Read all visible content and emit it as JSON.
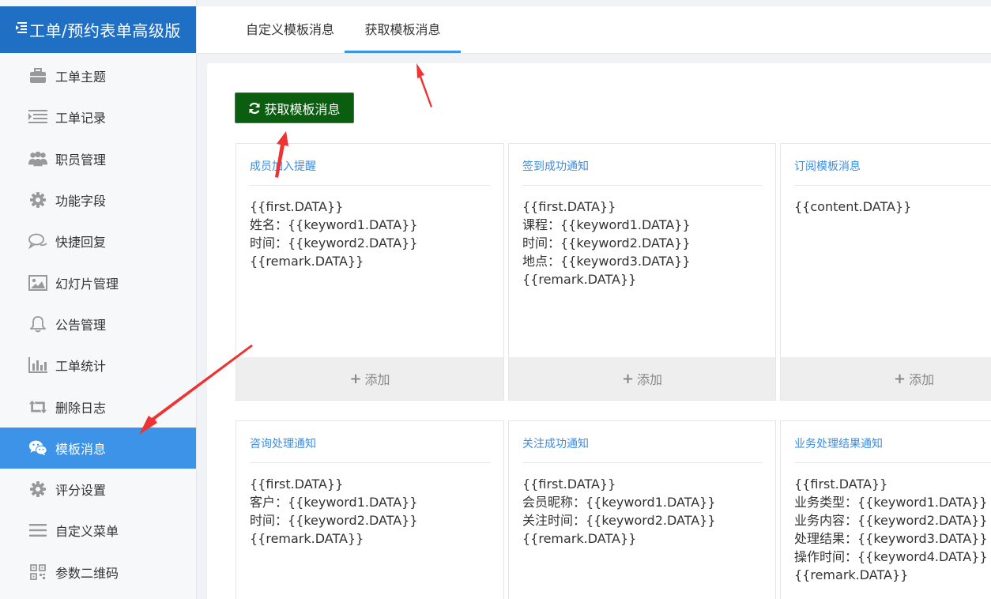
{
  "app": {
    "title": "工单/预约表单高级版"
  },
  "sidebar": {
    "items": [
      {
        "label": "工单主题",
        "icon": "briefcase-icon"
      },
      {
        "label": "工单记录",
        "icon": "list-icon"
      },
      {
        "label": "职员管理",
        "icon": "users-icon"
      },
      {
        "label": "功能字段",
        "icon": "gear-icon"
      },
      {
        "label": "快捷回复",
        "icon": "chat-bubble-icon"
      },
      {
        "label": "幻灯片管理",
        "icon": "image-icon"
      },
      {
        "label": "公告管理",
        "icon": "bell-icon"
      },
      {
        "label": "工单统计",
        "icon": "bar-chart-icon"
      },
      {
        "label": "删除日志",
        "icon": "retweet-icon"
      },
      {
        "label": "模板消息",
        "icon": "wechat-icon",
        "active": true
      },
      {
        "label": "评分设置",
        "icon": "gear-icon"
      },
      {
        "label": "自定义菜单",
        "icon": "menu-icon"
      },
      {
        "label": "参数二维码",
        "icon": "qrcode-icon"
      }
    ]
  },
  "tabs": [
    {
      "label": "自定义模板消息",
      "active": false
    },
    {
      "label": "获取模板消息",
      "active": true
    }
  ],
  "toolbar": {
    "fetch_label": "获取模板消息"
  },
  "cards": [
    {
      "title": "成员加入提醒",
      "body": "{{first.DATA}}\n姓名：{{keyword1.DATA}}\n时间：{{keyword2.DATA}}\n{{remark.DATA}}",
      "add_label": "添加"
    },
    {
      "title": "签到成功通知",
      "body": "{{first.DATA}}\n课程：{{keyword1.DATA}}\n时间：{{keyword2.DATA}}\n地点：{{keyword3.DATA}}\n{{remark.DATA}}",
      "add_label": "添加"
    },
    {
      "title": "订阅模板消息",
      "body": "{{content.DATA}}",
      "add_label": "添加"
    },
    {
      "title": "咨询处理通知",
      "body": "{{first.DATA}}\n客户：{{keyword1.DATA}}\n时间：{{keyword2.DATA}}\n{{remark.DATA}}"
    },
    {
      "title": "关注成功通知",
      "body": "{{first.DATA}}\n会员昵称：{{keyword1.DATA}}\n关注时间：{{keyword2.DATA}}\n{{remark.DATA}}"
    },
    {
      "title": "业务处理结果通知",
      "body": "{{first.DATA}}\n业务类型：{{keyword1.DATA}}\n业务内容：{{keyword2.DATA}}\n处理结果：{{keyword3.DATA}}\n操作时间：{{keyword4.DATA}}\n{{remark.DATA}}"
    }
  ],
  "colors": {
    "brand": "#1f6fc5",
    "active": "#3d93e8",
    "button": "#0b5d10",
    "title_link": "#3d8de0",
    "annotation_arrow": "#ee3333"
  }
}
